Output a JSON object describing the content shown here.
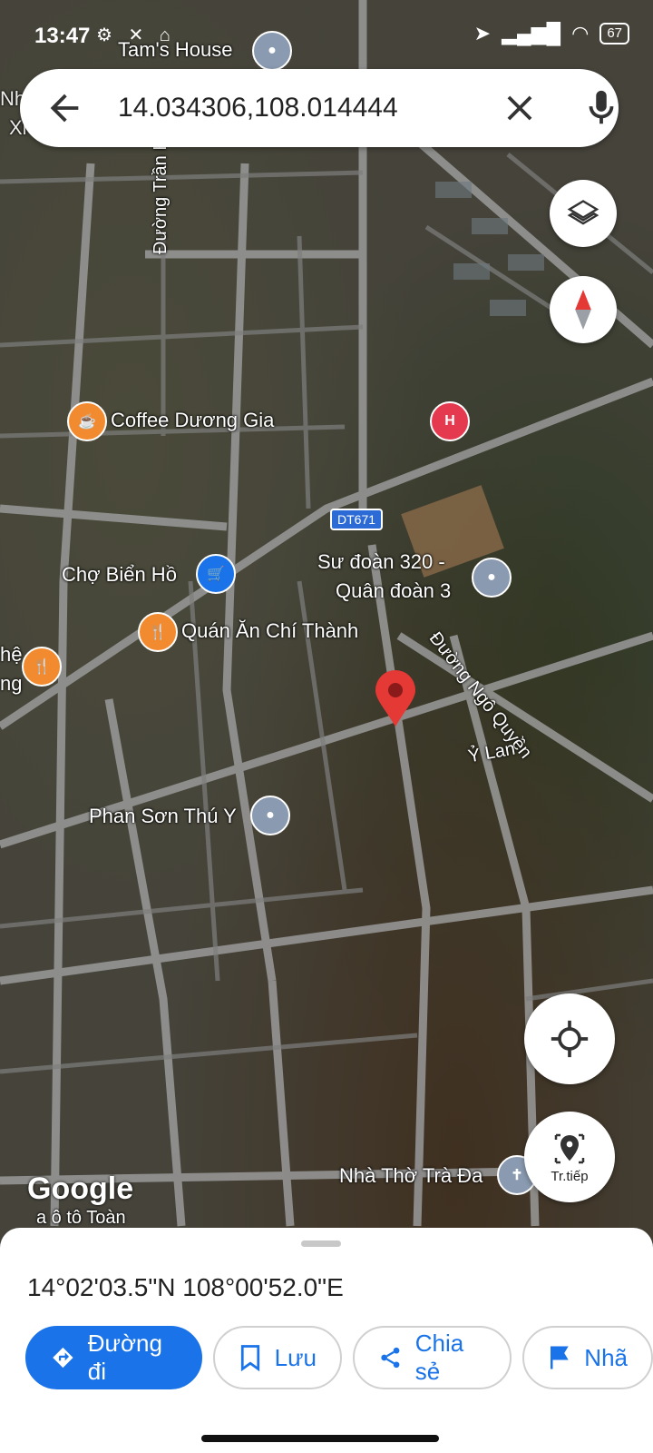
{
  "status": {
    "time": "13:47",
    "battery": "67"
  },
  "search": {
    "query": "14.034306,108.014444"
  },
  "map": {
    "labels": {
      "tams_house": "Tam's House",
      "coffee": "Coffee Dương Gia",
      "street_tran_huy_lieu": "Đường Trần Huy Liệu",
      "dt671": "DT671",
      "cho_bien_ho": "Chợ Biển Hồ",
      "su_doan": "Sư đoàn 320 -",
      "quan_doan": "Quân đoàn 3",
      "quan_an": "Quán Ăn Chí Thành",
      "street_ngo_quyen": "Đường Ngô Quyền",
      "y_lan": "Ỷ Lan",
      "phan_son": "Phan Sơn Thú Y",
      "nha_tho": "Nhà Thờ Trà Đa",
      "partial_left_1": "Nh",
      "partial_left_2": "Xi",
      "partial_left_3": "hệ",
      "partial_left_4": "ng",
      "partial_bottom": "a ô tô Toàn",
      "hospital_letter": "H"
    },
    "google_logo": "Google",
    "navigate_label": "Tr.tiếp"
  },
  "sheet": {
    "coordinates": "14°02'03.5\"N 108°00'52.0\"E",
    "actions": {
      "directions": "Đường đi",
      "save": "Lưu",
      "share": "Chia sẻ",
      "label": "Nhã"
    }
  }
}
